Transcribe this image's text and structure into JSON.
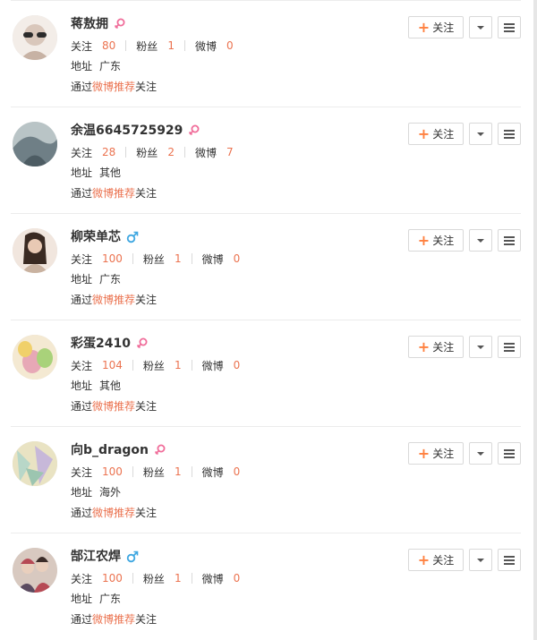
{
  "users": [
    {
      "name": "蒋敖拥",
      "gender": "female",
      "follow_label": "关注",
      "follow_count": "80",
      "fans_label": "粉丝",
      "fans_count": "1",
      "weibo_label": "微博",
      "weibo_count": "0",
      "address_label": "地址",
      "address": "广东",
      "via_prefix": "通过",
      "via_link": "微博推荐",
      "via_suffix": "关注",
      "button_label": "关注",
      "avatar_colors": [
        "#d9c7bb",
        "#f3ede8"
      ]
    },
    {
      "name": "余温6645725929",
      "gender": "female",
      "follow_label": "关注",
      "follow_count": "28",
      "fans_label": "粉丝",
      "fans_count": "2",
      "weibo_label": "微博",
      "weibo_count": "7",
      "address_label": "地址",
      "address": "其他",
      "via_prefix": "通过",
      "via_link": "微博推荐",
      "via_suffix": "关注",
      "button_label": "关注",
      "avatar_colors": [
        "#6f7f86",
        "#b9c4c6"
      ]
    },
    {
      "name": "柳荣单芯",
      "gender": "male",
      "follow_label": "关注",
      "follow_count": "100",
      "fans_label": "粉丝",
      "fans_count": "1",
      "weibo_label": "微博",
      "weibo_count": "0",
      "address_label": "地址",
      "address": "广东",
      "via_prefix": "通过",
      "via_link": "微博推荐",
      "via_suffix": "关注",
      "button_label": "关注",
      "avatar_colors": [
        "#c9b2a0",
        "#f1e6de"
      ]
    },
    {
      "name": "彩蛋2410",
      "gender": "female",
      "follow_label": "关注",
      "follow_count": "104",
      "fans_label": "粉丝",
      "fans_count": "1",
      "weibo_label": "微博",
      "weibo_count": "0",
      "address_label": "地址",
      "address": "其他",
      "via_prefix": "通过",
      "via_link": "微博推荐",
      "via_suffix": "关注",
      "button_label": "关注",
      "avatar_colors": [
        "#e7a8b6",
        "#a9d27a"
      ]
    },
    {
      "name": "向b_dragon",
      "gender": "female",
      "follow_label": "关注",
      "follow_count": "100",
      "fans_label": "粉丝",
      "fans_count": "1",
      "weibo_label": "微博",
      "weibo_count": "0",
      "address_label": "地址",
      "address": "海外",
      "via_prefix": "通过",
      "via_link": "微博推荐",
      "via_suffix": "关注",
      "button_label": "关注",
      "avatar_colors": [
        "#b8d7c8",
        "#e9e3c3"
      ]
    },
    {
      "name": "郜江农焊",
      "gender": "male",
      "follow_label": "关注",
      "follow_count": "100",
      "fans_label": "粉丝",
      "fans_count": "1",
      "weibo_label": "微博",
      "weibo_count": "0",
      "address_label": "地址",
      "address": "广东",
      "via_prefix": "通过",
      "via_link": "微博推荐",
      "via_suffix": "关注",
      "button_label": "关注",
      "avatar_colors": [
        "#b64a55",
        "#d8c9c0"
      ]
    }
  ],
  "colors": {
    "accent": "#eb7350",
    "female": "#f06d9a",
    "male": "#3fa7e1",
    "plus": "#ff8140"
  },
  "icons": {
    "female": "female-symbol-icon",
    "male": "male-symbol-icon",
    "dropdown": "caret-down-icon",
    "menu": "hamburger-icon",
    "follow": "plus-icon"
  }
}
